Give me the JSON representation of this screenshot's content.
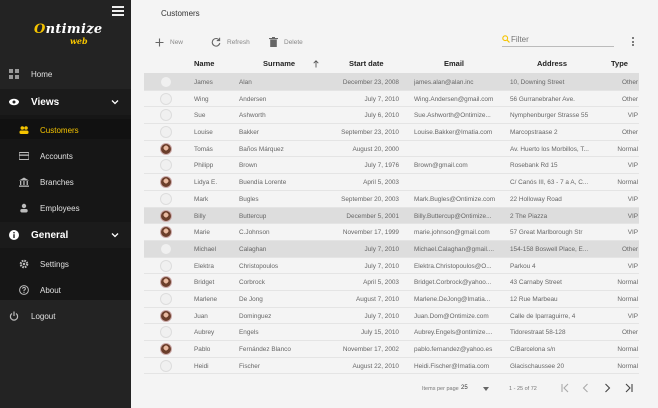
{
  "app": {
    "logo_main": "Ontimize",
    "logo_sub": "web"
  },
  "sidebar": {
    "home": "Home",
    "views": "Views",
    "views_items": [
      "Customers",
      "Accounts",
      "Branches",
      "Employees"
    ],
    "general": "General",
    "general_items": [
      "Settings",
      "About"
    ],
    "logout": "Logout"
  },
  "breadcrumb": "Customers",
  "toolbar": {
    "new": "New",
    "refresh": "Refresh",
    "delete": "Delete",
    "filter_placeholder": "Filter"
  },
  "table": {
    "columns": [
      "Name",
      "Surname",
      "Start date",
      "Email",
      "Address",
      "Type"
    ],
    "rows": [
      {
        "name": "James",
        "surname": "Alan",
        "date": "December 23, 2008",
        "email": "james.alan@alan.inc",
        "address": "10, Downing Street",
        "type": "Other",
        "photo": false,
        "hl": true
      },
      {
        "name": "Wing",
        "surname": "Andersen",
        "date": "July 7, 2010",
        "email": "Wing.Andersen@gmail.com",
        "address": "56 Gurranebraher Ave.",
        "type": "Other",
        "photo": false,
        "hl": false
      },
      {
        "name": "Sue",
        "surname": "Ashworth",
        "date": "July 6, 2010",
        "email": "Sue.Ashworth@Ontimize...",
        "address": "Nymphenburger Strasse 55",
        "type": "VIP",
        "photo": false,
        "hl": false
      },
      {
        "name": "Louise",
        "surname": "Bakker",
        "date": "September 23, 2010",
        "email": "Louise.Bakker@Imatia.com",
        "address": "Marcopstraase 2",
        "type": "Other",
        "photo": false,
        "hl": false
      },
      {
        "name": "Tomás",
        "surname": "Baños Márquez",
        "date": "August 20, 2000",
        "email": "",
        "address": "Av. Huerto los Morbillos, T...",
        "type": "Normal",
        "photo": true,
        "hl": false
      },
      {
        "name": "Philipp",
        "surname": "Brown",
        "date": "July 7, 1976",
        "email": "Brown@gmail.com",
        "address": "Rosebank Rd 15",
        "type": "VIP",
        "photo": false,
        "hl": false
      },
      {
        "name": "Lidya E.",
        "surname": "Buendía Lorente",
        "date": "April 5, 2003",
        "email": "",
        "address": "C/ Canós III, 63 - 7 a A, C...",
        "type": "Normal",
        "photo": true,
        "hl": false
      },
      {
        "name": "Mark",
        "surname": "Bugles",
        "date": "September 20, 2003",
        "email": "Mark.Bugles@Ontimize.com",
        "address": "22 Holloway Road",
        "type": "VIP",
        "photo": false,
        "hl": false
      },
      {
        "name": "Billy",
        "surname": "Buttercup",
        "date": "December 5, 2001",
        "email": "Billy.Buttercup@Ontimize...",
        "address": "2 The Piazza",
        "type": "VIP",
        "photo": true,
        "hl": true
      },
      {
        "name": "Marie",
        "surname": "C.Johnson",
        "date": "November 17, 1999",
        "email": "marie.johnson@gmail.com",
        "address": "57 Great Marlborough Str",
        "type": "VIP",
        "photo": true,
        "hl": false
      },
      {
        "name": "Michael",
        "surname": "Calaghan",
        "date": "July 7, 2010",
        "email": "Michael.Calaghan@gmail....",
        "address": "154-158 Boswell Place, E...",
        "type": "Other",
        "photo": false,
        "hl": true
      },
      {
        "name": "Elektra",
        "surname": "Christopoulos",
        "date": "July 7, 2010",
        "email": "Elektra.Christopoulos@O...",
        "address": "Parkou 4",
        "type": "VIP",
        "photo": false,
        "hl": false
      },
      {
        "name": "Bridget",
        "surname": "Corbrock",
        "date": "April 5, 2003",
        "email": "Bridget.Corbrock@yahoo...",
        "address": "43 Carnaby Street",
        "type": "Normal",
        "photo": true,
        "hl": false
      },
      {
        "name": "Marlene",
        "surname": "De Jong",
        "date": "August 7, 2010",
        "email": "Marlene.DeJong@Imatia...",
        "address": "12 Rue Marbeau",
        "type": "Normal",
        "photo": false,
        "hl": false
      },
      {
        "name": "Juan",
        "surname": "Dominguez",
        "date": "July 7, 2010",
        "email": "Juan.Dom@Ontimize.com",
        "address": "Calle de Iparraguirre, 4",
        "type": "VIP",
        "photo": true,
        "hl": false
      },
      {
        "name": "Aubrey",
        "surname": "Engels",
        "date": "July 15, 2010",
        "email": "Aubrey.Engels@ontimize....",
        "address": "Tidorestraat 58-128",
        "type": "Other",
        "photo": false,
        "hl": false
      },
      {
        "name": "Pablo",
        "surname": "Fernández Blanco",
        "date": "November 17, 2002",
        "email": "pablo.fernandez@yahoo.es",
        "address": "C/Barcelona s/n",
        "type": "Normal",
        "photo": true,
        "hl": false
      },
      {
        "name": "Heidi",
        "surname": "Fischer",
        "date": "August 22, 2010",
        "email": "Heidi.Fischer@Imatia.com",
        "address": "Glacischaussee 20",
        "type": "Normal",
        "photo": false,
        "hl": false
      }
    ]
  },
  "pager": {
    "items_per_page_label": "Items per page",
    "items_per_page_value": "25",
    "range": "1 - 25 of 72"
  },
  "colors": {
    "accent": "#f5c400",
    "sidebar_bg": "#232323"
  }
}
